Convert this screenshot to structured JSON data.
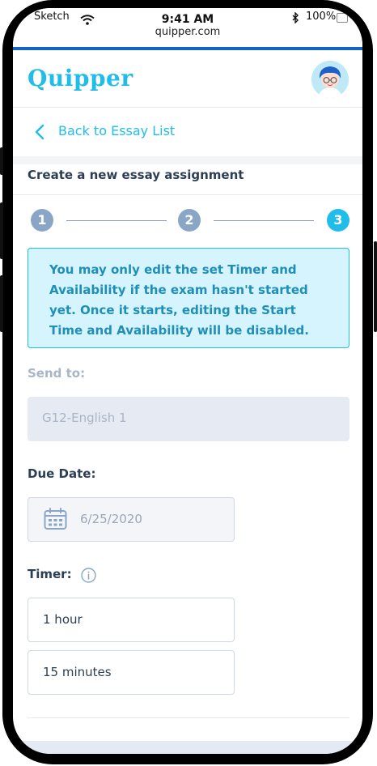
{
  "status_bar": {
    "carrier": "Sketch",
    "time": "9:41 AM",
    "url": "quipper.com",
    "battery": "100%"
  },
  "header": {
    "logo": "Quipper"
  },
  "nav": {
    "back_label": "Back to Essay List"
  },
  "page": {
    "title": "Create a new essay assignment"
  },
  "stepper": {
    "steps": [
      {
        "label": "1",
        "state": "completed"
      },
      {
        "label": "2",
        "state": "completed"
      },
      {
        "label": "3",
        "state": "current"
      }
    ]
  },
  "notice": {
    "text": "You may only edit the set Timer and Availability if the exam hasn't started yet. Once it starts, editing the Start Time and Availability will be disabled."
  },
  "form": {
    "send_to": {
      "label": "Send to:",
      "value": "G12-English 1"
    },
    "due_date": {
      "label": "Due Date:",
      "value": "6/25/2020"
    },
    "timer": {
      "label": "Timer:",
      "hours": "1 hour",
      "minutes": "15 minutes"
    }
  },
  "colors": {
    "brand": "#20bcea",
    "accent_bar": "#1565c0",
    "step_completed": "#8aa6c6",
    "notice_bg": "#d6f4fd",
    "text_dark": "#2c3e55"
  }
}
